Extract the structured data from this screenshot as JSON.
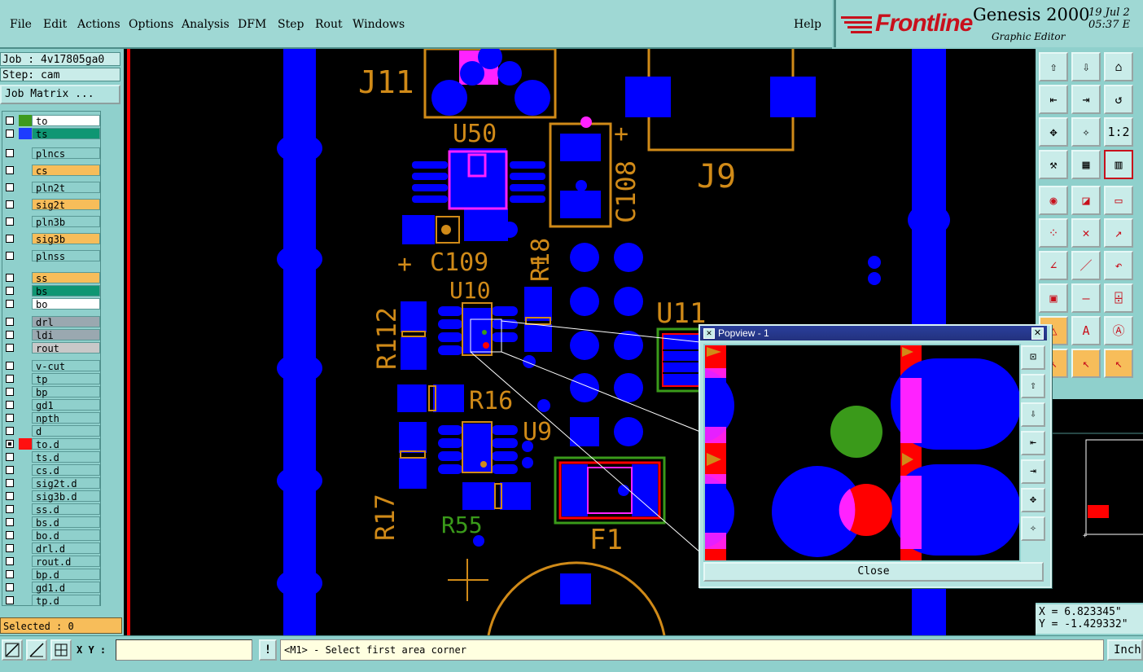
{
  "menubar": {
    "items": [
      "File",
      "Edit",
      "Actions",
      "Options",
      "Analysis",
      "DFM",
      "Step",
      "Rout",
      "Windows"
    ],
    "help": "Help"
  },
  "brand": {
    "logo": "Frontline",
    "title": "Genesis 2000",
    "subtitle": "Graphic Editor",
    "date": "19 Jul 2",
    "time": "05:37 E"
  },
  "job": {
    "job_line": "Job : 4v17805ga0",
    "step_line": "Step: cam",
    "matrix_button": "Job Matrix ..."
  },
  "layers": [
    {
      "name": "to",
      "swatch": "#3e9a1e",
      "bg": "#ffffff"
    },
    {
      "name": "ts",
      "swatch": "#1e3cff",
      "bg": "#0f9673"
    },
    {
      "name": "plncs",
      "swatch": "",
      "bg": "#8fd0cc"
    },
    {
      "name": "cs",
      "swatch": "",
      "bg": "#f7bd5a"
    },
    {
      "name": "pln2t",
      "swatch": "",
      "bg": "#8fd0cc"
    },
    {
      "name": "sig2t",
      "swatch": "",
      "bg": "#f7bd5a"
    },
    {
      "name": "pln3b",
      "swatch": "",
      "bg": "#8fd0cc"
    },
    {
      "name": "sig3b",
      "swatch": "",
      "bg": "#f7bd5a"
    },
    {
      "name": "plnss",
      "swatch": "",
      "bg": "#8fd0cc"
    },
    {
      "name": "ss",
      "swatch": "",
      "bg": "#f7bd5a"
    },
    {
      "name": "bs",
      "swatch": "",
      "bg": "#0f9673"
    },
    {
      "name": "bo",
      "swatch": "",
      "bg": "#ffffff"
    },
    {
      "name": "drl",
      "swatch": "",
      "bg": "#9aa8b0"
    },
    {
      "name": "ldi",
      "swatch": "",
      "bg": "#9aa8b0"
    },
    {
      "name": "rout",
      "swatch": "",
      "bg": "#c8c8c8"
    },
    {
      "name": "v-cut",
      "swatch": "",
      "bg": "#8fd0cc"
    },
    {
      "name": "tp",
      "swatch": "",
      "bg": "#8fd0cc"
    },
    {
      "name": "bp",
      "swatch": "",
      "bg": "#8fd0cc"
    },
    {
      "name": "gd1",
      "swatch": "",
      "bg": "#8fd0cc"
    },
    {
      "name": "npth",
      "swatch": "",
      "bg": "#8fd0cc"
    },
    {
      "name": "d",
      "swatch": "",
      "bg": "#8fd0cc"
    },
    {
      "name": "to.d",
      "swatch": "#ff1010",
      "bg": "#8fd0cc"
    },
    {
      "name": "ts.d",
      "swatch": "",
      "bg": "#8fd0cc"
    },
    {
      "name": "cs.d",
      "swatch": "",
      "bg": "#8fd0cc"
    },
    {
      "name": "sig2t.d",
      "swatch": "",
      "bg": "#8fd0cc"
    },
    {
      "name": "sig3b.d",
      "swatch": "",
      "bg": "#8fd0cc"
    },
    {
      "name": "ss.d",
      "swatch": "",
      "bg": "#8fd0cc"
    },
    {
      "name": "bs.d",
      "swatch": "",
      "bg": "#8fd0cc"
    },
    {
      "name": "bo.d",
      "swatch": "",
      "bg": "#8fd0cc"
    },
    {
      "name": "drl.d",
      "swatch": "",
      "bg": "#8fd0cc"
    },
    {
      "name": "rout.d",
      "swatch": "",
      "bg": "#8fd0cc"
    },
    {
      "name": "bp.d",
      "swatch": "",
      "bg": "#8fd0cc"
    },
    {
      "name": "gd1.d",
      "swatch": "",
      "bg": "#8fd0cc"
    },
    {
      "name": "tp.d",
      "swatch": "",
      "bg": "#8fd0cc"
    }
  ],
  "selected": "Selected : 0",
  "canvas": {
    "refdes": [
      "J11",
      "U50",
      "C108",
      "J9",
      "C109",
      "R18",
      "U10",
      "R112",
      "U11",
      "R16",
      "U9",
      "R17",
      "R55",
      "F1"
    ]
  },
  "popview": {
    "title": "Popview - 1",
    "close_label": "Close"
  },
  "coords": {
    "x": "X = 6.823345\"",
    "y": "Y = -1.429332\""
  },
  "status": {
    "xy_label": "X Y :",
    "xy_value": "",
    "prompt": "<M1> - Select first area corner",
    "units": "Inch"
  },
  "colors": {
    "copper": "#0000ff",
    "silk": "#d08a18",
    "mask": "#ff22ff",
    "highlight": "#ff0000",
    "drill": "#3a9a1a"
  },
  "toolbar": {
    "icons": [
      "zoom-home-icon",
      "zoom-prev-icon",
      "home-icon",
      "pan-left-icon",
      "pan-right-icon",
      "redraw-icon",
      "zoom-in-icon",
      "zoom-out-icon",
      "one-to-one-icon",
      "measure-icon",
      "grid-icon",
      "snap-icon",
      "select-icon",
      "cut-icon",
      "ruler-icon",
      "connect-icon",
      "delete-icon",
      "move-icon",
      "line-icon",
      "slash-icon",
      "arc-icon",
      "pad-icon",
      "minus-icon",
      "resize-icon",
      "triangle-icon",
      "text-a-icon",
      "text-a2-icon",
      "pointer-icon",
      "pointer2-icon",
      "pointer3-icon"
    ]
  }
}
